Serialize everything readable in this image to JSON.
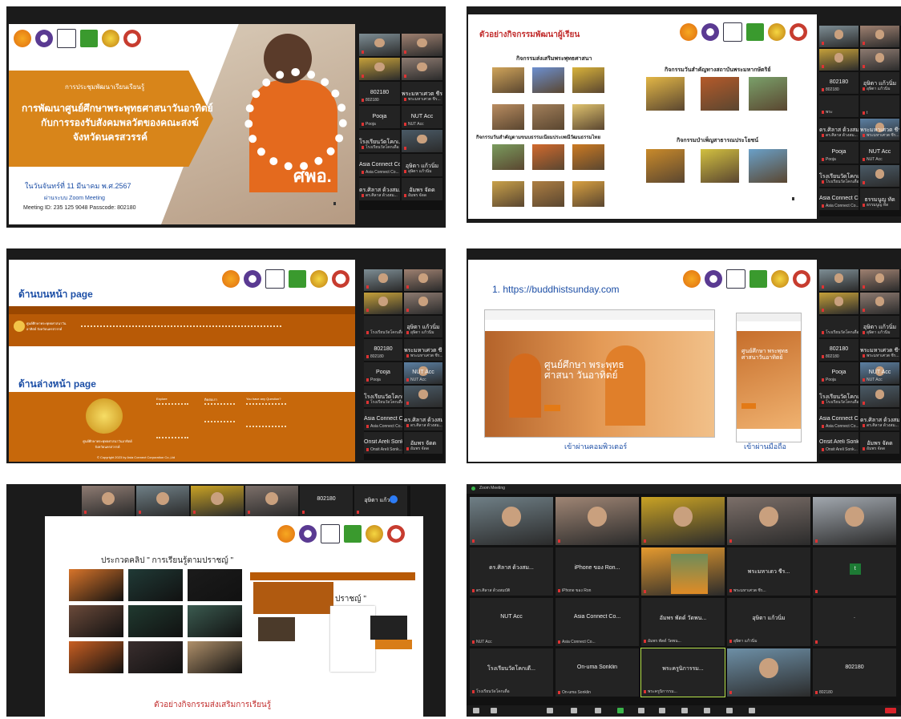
{
  "panel1": {
    "meeting_label": "การประชุมพัฒนาเรียนเรียนรู้",
    "title_lines": [
      "การพัฒนาศูนย์ศึกษาพระพุทธศาสนาวันอาทิตย์",
      "กับการรองรับสังคมพลวัตของคณะสงฆ์",
      "จังหวัดนครสวรรค์"
    ],
    "date": "ในวันจันทร์ที่ 11 มีนาคม พ.ศ.2567",
    "platform": "ผ่านระบบ Zoom Meeting",
    "meeting_id": "Meeting ID: 235 125 9048 Passcode: 802180",
    "shirt_text": "ศพอ.",
    "participants": [
      {
        "name": "",
        "cap": ""
      },
      {
        "name": "",
        "cap": ""
      },
      {
        "name": "",
        "cap": ""
      },
      {
        "name": "",
        "cap": ""
      },
      {
        "name": "802180",
        "cap": "802180"
      },
      {
        "name": "พระมหาเศวต ชีร...",
        "cap": "พระมหาเศวต ชีร..."
      },
      {
        "name": "Pooja",
        "cap": "Pooja"
      },
      {
        "name": "NUT Acc",
        "cap": "NUT Acc"
      },
      {
        "name": "โรงเรียนวัดโคกเ...",
        "cap": "โรงเรียนวัดโคกเดื่อ"
      },
      {
        "name": "",
        "cap": ""
      },
      {
        "name": "Asia Connect Co...",
        "cap": "Asia Connect Co..."
      },
      {
        "name": "อุษิตา แก้วนิ่ม",
        "cap": "อุษิตา แก้วนิ่ม"
      },
      {
        "name": "ดร.ศิลาส ด้วงสม...",
        "cap": "ดร.ศิลาส ด้วงสม..."
      },
      {
        "name": "อัมพร จัดด",
        "cap": "อัมพร จัดด"
      }
    ]
  },
  "panel2": {
    "heading": "ตัวอย่างกิจกรรมพัฒนาผู้เรียน",
    "sections": [
      "กิจกรรมส่งเสริมพระพุทธศาสนา",
      "กิจกรรมวันสำคัญทางสถาบันพระมหากษัตริย์",
      "กิจกรรมวันสำคัญตามขนบธรรมเนียมประเพณีวัฒนธรรมไทย",
      "กิจกรรมบำเพ็ญสาธารณประโยชน์"
    ],
    "participants": [
      {
        "name": "",
        "cap": ""
      },
      {
        "name": "",
        "cap": ""
      },
      {
        "name": "",
        "cap": ""
      },
      {
        "name": "",
        "cap": ""
      },
      {
        "name": "802180",
        "cap": "802180"
      },
      {
        "name": "อุษิตา แก้วนิ่ม",
        "cap": "อุษิตา แก้วนิ่ม"
      },
      {
        "name": "",
        "cap": "พระ"
      },
      {
        "name": "",
        "cap": "t"
      },
      {
        "name": "ดร.ศิลาส ด้วงสม...",
        "cap": "ดร.ศิลาส ด้วงสม..."
      },
      {
        "name": "พระมหาเศวต ชีร...",
        "cap": "พระมหาเศวต ชีร..."
      },
      {
        "name": "Pooja",
        "cap": "Pooja"
      },
      {
        "name": "NUT Acc",
        "cap": "NUT Acc"
      },
      {
        "name": "โรงเรียนวัดโคกเดื่อ",
        "cap": "โรงเรียนวัดโคกเดื่อ"
      },
      {
        "name": "",
        "cap": ""
      },
      {
        "name": "Asia Connect Co...",
        "cap": "Asia Connect Co..."
      },
      {
        "name": "ธรรมนูญ ทัด",
        "cap": "ธรรมนูญ ทัด"
      }
    ]
  },
  "panel3": {
    "top_label": "ด้านบนหน้า page",
    "bottom_label": "ด้านล่างหน้า page",
    "site_name": "ศูนย์ศึกษาพระพุทธศาสนาวันอาทิตย์ จังหวัดนครสวรรค์",
    "copyright": "© Copyright 2023 by Asia Connect Corporation Co.,Ltd",
    "footer_cols": [
      "Explore",
      "ติดต่อเรา",
      "You have any Question?"
    ],
    "participants": [
      {
        "name": "",
        "cap": ""
      },
      {
        "name": "",
        "cap": ""
      },
      {
        "name": "",
        "cap": ""
      },
      {
        "name": "",
        "cap": ""
      },
      {
        "name": "",
        "cap": "โรงเรียนวัดโคกเดื่อ"
      },
      {
        "name": "อุษิตา แก้วนิ่ม",
        "cap": "อุษิตา แก้วนิ่ม"
      },
      {
        "name": "802180",
        "cap": "802180"
      },
      {
        "name": "พระมหาเศวต ชีร...",
        "cap": "พระมหาเศวต ชีร..."
      },
      {
        "name": "Pooja",
        "cap": "Pooja"
      },
      {
        "name": "NUT Acc",
        "cap": "NUT Acc"
      },
      {
        "name": "โรงเรียนวัดโคกเ...",
        "cap": "โรงเรียนวัดโคกเดื่อ"
      },
      {
        "name": "",
        "cap": ""
      },
      {
        "name": "Asia Connect Co...",
        "cap": "Asia Connect Co..."
      },
      {
        "name": "ดร.ศิลาส ด้วงสม...",
        "cap": "ดร.ศิลาส ด้วงสม..."
      },
      {
        "name": "Onsit Areli Sonk...",
        "cap": "Onsit Areli Sonk..."
      },
      {
        "name": "อัมพร จัดด",
        "cap": "อัมพร จัดด"
      }
    ]
  },
  "panel4": {
    "url_label": "1. https://buddhistsunday.com",
    "hero_title": "ศูนย์ศึกษา พระพุทธศาสนา วันอาทิตย์",
    "mobile_hero": "ศูนย์ศึกษา พระพุทธ ศาสนาวันอาทิตย์",
    "desktop_caption": "เข้าผ่านคอมพิวเตอร์",
    "mobile_caption": "เข้าผ่านมือถือ",
    "participants": [
      {
        "name": "",
        "cap": ""
      },
      {
        "name": "",
        "cap": ""
      },
      {
        "name": "",
        "cap": ""
      },
      {
        "name": "",
        "cap": ""
      },
      {
        "name": "",
        "cap": "โรงเรียนวัดโคกเดื่อ"
      },
      {
        "name": "อุษิตา แก้วนิ่ม",
        "cap": "อุษิตา แก้วนิ่ม"
      },
      {
        "name": "802180",
        "cap": "802180"
      },
      {
        "name": "พระมหาเศวต ชีร...",
        "cap": "พระมหาเศวต ชีร..."
      },
      {
        "name": "Pooja",
        "cap": "Pooja"
      },
      {
        "name": "NUT Acc",
        "cap": "NUT Acc"
      },
      {
        "name": "โรงเรียนวัดโคกเ...",
        "cap": "โรงเรียนวัดโคกเดื่อ"
      },
      {
        "name": "",
        "cap": ""
      },
      {
        "name": "Asia Connect Co...",
        "cap": "Asia Connect Co..."
      },
      {
        "name": "ดร.ศิลาส ด้วงสม...",
        "cap": "ดร.ศิลาส ด้วงสม..."
      },
      {
        "name": "Onsit Areli Sonk...",
        "cap": "Onsit Areli Sonk..."
      },
      {
        "name": "อัมพร จัดด",
        "cap": "อัมพร จัดด"
      }
    ]
  },
  "panel5": {
    "contest_title": "ประกวดคลิป \" การเรียนรู้ตามปราชญ์ \"",
    "overlay_fragment": "ปราชญ์ \"",
    "footer": "ตัวอย่างกิจกรรมส่งเสริมการเรียนรู้",
    "top_strip": [
      {
        "name": "",
        "cap": ""
      },
      {
        "name": "",
        "cap": ""
      },
      {
        "name": "",
        "cap": ""
      },
      {
        "name": "",
        "cap": ""
      },
      {
        "name": "802180",
        "cap": ""
      },
      {
        "name": "อุษิตา แก้วนิ่ม",
        "cap": ""
      }
    ]
  },
  "panel6": {
    "window_title": "Zoom Meeting",
    "grid": [
      {
        "name": "",
        "cap": "",
        "photo": "#6f7f86"
      },
      {
        "name": "",
        "cap": "",
        "photo": "#9f8574"
      },
      {
        "name": "",
        "cap": "",
        "photo": "#c9a224"
      },
      {
        "name": "",
        "cap": "",
        "photo": "#7c6f69"
      },
      {
        "name": "",
        "cap": "",
        "photo": "#a1a7ae"
      },
      {
        "name": "ดร.ศิลาส ด้วงสม...",
        "cap": "ดร.ศิลาส ด้วงสมบัติ",
        "photo": ""
      },
      {
        "name": "iPhone ของ Ron...",
        "cap": "iPhone ของ Ron",
        "photo": ""
      },
      {
        "name": "",
        "cap": "",
        "photo": "#e59a2e"
      },
      {
        "name": "พระมหาเดว ชีร...",
        "cap": "พระมหาเศวต ชีร...",
        "photo": ""
      },
      {
        "name": "t",
        "cap": "",
        "photo": ""
      },
      {
        "name": "NUT Acc",
        "cap": "NUT Acc",
        "photo": ""
      },
      {
        "name": "Asia Connect Co...",
        "cap": "Asia Connect Co...",
        "photo": ""
      },
      {
        "name": "อัมพร พัดด์ วัดพน...",
        "cap": "อัมพร พัดด์ วัดพน...",
        "photo": ""
      },
      {
        "name": "อุษิตา แก้วนิ่ม",
        "cap": "อุษิตา แก้วนิ่ม",
        "photo": ""
      },
      {
        "name": ".",
        "cap": "",
        "photo": ""
      },
      {
        "name": "โรงเรียนวัดโคกเดื...",
        "cap": "โรงเรียนวัดโคกเดื่อ",
        "photo": ""
      },
      {
        "name": "On-uma Sonklin",
        "cap": "On-uma Sonklin",
        "photo": ""
      },
      {
        "name": "พระครูนิการรม...",
        "cap": "พระครูนิการรม...",
        "photo": ""
      },
      {
        "name": "",
        "cap": "",
        "photo": "#6d8fa6"
      },
      {
        "name": "802180",
        "cap": "802180",
        "photo": ""
      }
    ]
  }
}
